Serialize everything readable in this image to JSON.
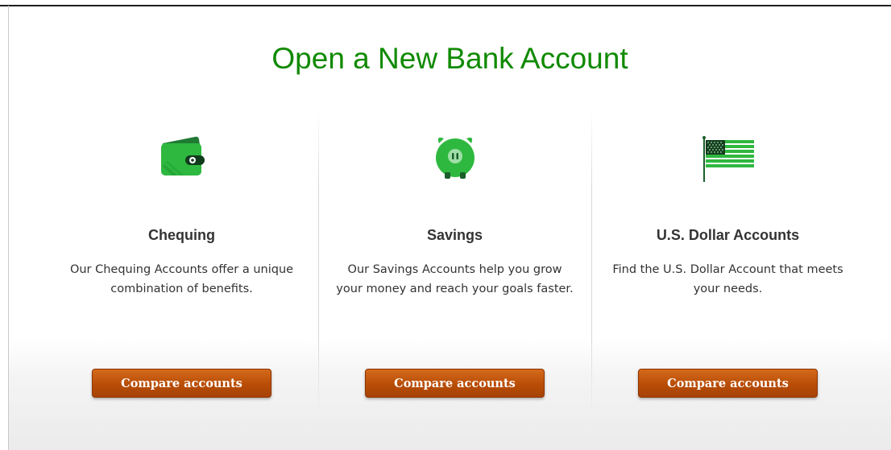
{
  "page": {
    "title": "Open a New Bank Account"
  },
  "accounts": [
    {
      "icon": "wallet-icon",
      "title": "Chequing",
      "description": "Our Chequing Accounts offer a unique combination of benefits.",
      "button_label": "Compare accounts"
    },
    {
      "icon": "piggy-bank-icon",
      "title": "Savings",
      "description": "Our Savings Accounts help you grow your money and reach your goals faster.",
      "button_label": "Compare accounts"
    },
    {
      "icon": "us-flag-icon",
      "title": "U.S. Dollar Accounts",
      "description": "Find the U.S. Dollar Account that meets your needs.",
      "button_label": "Compare accounts"
    }
  ],
  "colors": {
    "title_green": "#108a00",
    "icon_green": "#2eb83f",
    "button_orange": "#b84d06",
    "text_dark": "#333333"
  }
}
